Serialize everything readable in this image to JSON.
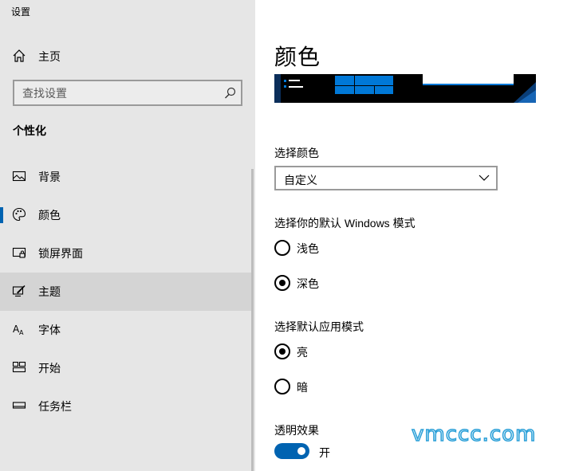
{
  "app": {
    "title": "设置"
  },
  "sidebar": {
    "home_label": "主页",
    "search_placeholder": "查找设置",
    "section_title": "个性化",
    "items": [
      {
        "label": "背景",
        "icon": "picture-icon",
        "selected": false
      },
      {
        "label": "颜色",
        "icon": "palette-icon",
        "selected": false
      },
      {
        "label": "锁屏界面",
        "icon": "lock-screen-icon",
        "selected": false
      },
      {
        "label": "主题",
        "icon": "theme-brush-icon",
        "selected": true
      },
      {
        "label": "字体",
        "icon": "font-icon",
        "selected": false
      },
      {
        "label": "开始",
        "icon": "start-icon",
        "selected": false
      },
      {
        "label": "任务栏",
        "icon": "taskbar-icon",
        "selected": false
      }
    ]
  },
  "main": {
    "title": "颜色",
    "choose_color_label": "选择颜色",
    "choose_color_value": "自定义",
    "windows_mode_label": "选择你的默认 Windows 模式",
    "windows_mode_options": [
      {
        "label": "浅色",
        "checked": false
      },
      {
        "label": "深色",
        "checked": true
      }
    ],
    "app_mode_label": "选择默认应用模式",
    "app_mode_options": [
      {
        "label": "亮",
        "checked": true
      },
      {
        "label": "暗",
        "checked": false
      }
    ],
    "transparency_label": "透明效果",
    "transparency_state": "开",
    "transparency_on": true
  },
  "watermark": "vmccc.com",
  "colors": {
    "accent": "#0063b1",
    "sidebar_bg": "#e6e6e6",
    "selected_bg": "#d4d4d4"
  }
}
